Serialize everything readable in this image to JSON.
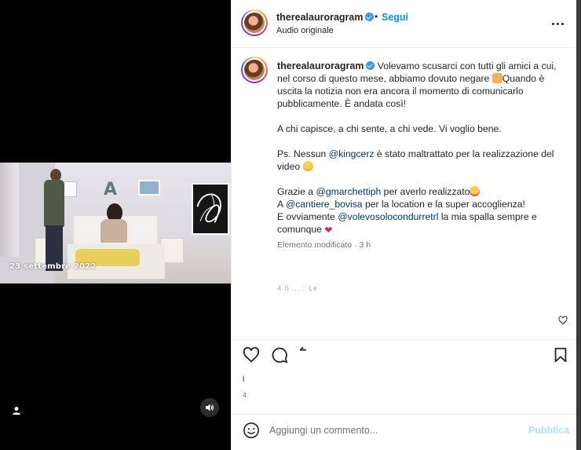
{
  "media": {
    "overlay_date": "23 settembre 2022",
    "user_tag_icon": "person-icon",
    "mute_icon": "speaker-icon"
  },
  "post": {
    "username": "therealauroragram",
    "separator": "•",
    "follow_label": "Segui",
    "audio_label": "Audio originale",
    "more_icon": "more-horizontal-icon"
  },
  "caption": {
    "username": "therealauroragram",
    "p1": "Volevamo scusarci con tutti gli amici a cui, nel corso di questo mese, abbiamo dovuto negare ",
    "p1b": "Quando è uscita la notizia non era ancora il momento di comunicarlo pubblicamente. È andata così!",
    "p2": "A chi capisce, a chi sente, a chi vede. Vi voglio bene.",
    "p3a": "Ps. Nessun ",
    "p3_mention": "@kingcerz",
    "p3b": " è stato maltrattato per la realizzazione del video ",
    "p4a": "Grazie a ",
    "p4_mention": "@gmarchettiph",
    "p4b": " per averlo realizzato",
    "p5a": "A ",
    "p5_mention": "@cantiere_bovisa",
    "p5b": " per la location e la super accoglienza!",
    "p6a": "E ovviamente ",
    "p6_mention": "@volevosolocondurretrl",
    "p6b": " la mia spalla sempre e comunque ",
    "edited": "Elemento modificato · 3 h",
    "faded_line": "4 0 ... : Le"
  },
  "actions": {
    "like_icon": "heart-icon",
    "comment_icon": "comment-icon",
    "share_icon": "share-icon",
    "save_icon": "bookmark-icon",
    "likes_partial": "l",
    "time_partial": "4"
  },
  "comment": {
    "placeholder": "Aggiungi un commento...",
    "publish_label": "Pubblica",
    "emoji_icon": "smiley-icon"
  },
  "colors": {
    "accent": "#0095f6",
    "publish_disabled": "#b2dffc",
    "mention": "#00376b",
    "verified": "#3897f0"
  }
}
